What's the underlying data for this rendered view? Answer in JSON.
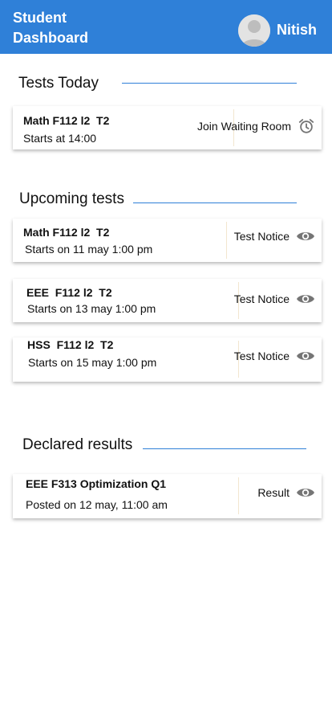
{
  "header": {
    "title": "Student Dashboard",
    "user_name": "Nitish",
    "background": "#2f80d8"
  },
  "tests_today": {
    "title": "Tests Today",
    "items": [
      {
        "title": "Math F112 l2  T2",
        "subtitle": "Starts at 14:00",
        "action_label": "Join Waiting Room",
        "action_icon": "alarm-clock-icon"
      }
    ]
  },
  "upcoming": {
    "title": "Upcoming tests",
    "items": [
      {
        "title": "Math F112 l2  T2",
        "subtitle": "Starts on 11 may 1:00 pm",
        "action_label": "Test Notice",
        "action_icon": "eye-icon"
      },
      {
        "title": "EEE  F112 l2  T2",
        "subtitle": "Starts on 13 may 1:00 pm",
        "action_label": "Test Notice",
        "action_icon": "eye-icon"
      },
      {
        "title": "HSS  F112 l2  T2",
        "subtitle": "Starts on 15 may 1:00 pm",
        "action_label": "Test Notice",
        "action_icon": "eye-icon"
      }
    ]
  },
  "declared": {
    "title": "Declared results",
    "items": [
      {
        "title": "EEE F313 Optimization Q1",
        "subtitle": "Posted on 12 may, 11:00 am",
        "action_label": "Result",
        "action_icon": "eye-icon"
      }
    ]
  },
  "colors": {
    "accent": "#2f80d8",
    "icon": "#757575"
  }
}
